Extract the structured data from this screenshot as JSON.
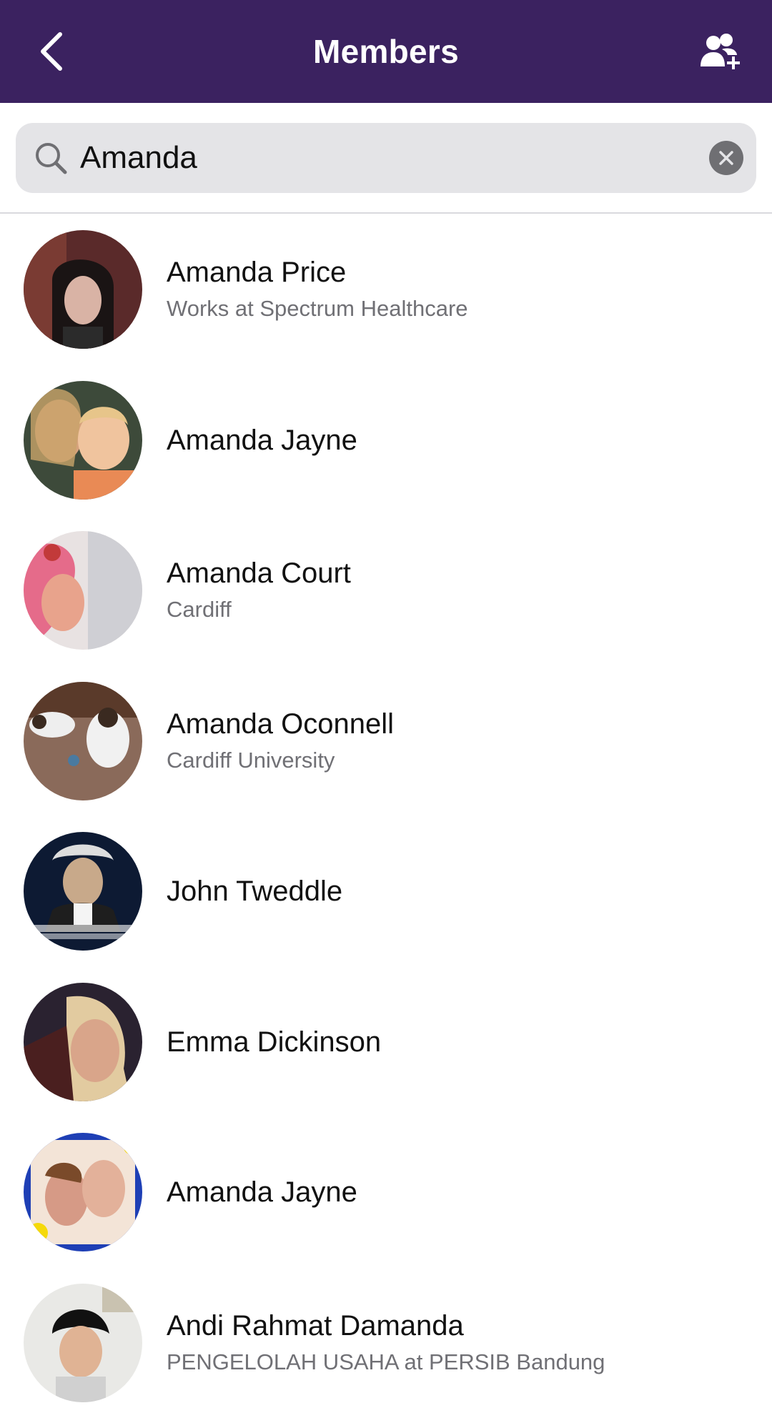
{
  "header": {
    "title": "Members",
    "back_icon": "chevron-left-icon",
    "add_icon": "add-member-icon",
    "background_color": "#3b2260"
  },
  "search": {
    "value": "Amanda",
    "placeholder": "Search",
    "search_icon": "search-icon",
    "clear_icon": "clear-circle-icon"
  },
  "members": [
    {
      "name": "Amanda Price",
      "subtitle": "Works at Spectrum Healthcare"
    },
    {
      "name": "Amanda Jayne",
      "subtitle": ""
    },
    {
      "name": "Amanda Court",
      "subtitle": "Cardiff"
    },
    {
      "name": "Amanda Oconnell",
      "subtitle": "Cardiff University"
    },
    {
      "name": "John Tweddle",
      "subtitle": ""
    },
    {
      "name": "Emma Dickinson",
      "subtitle": ""
    },
    {
      "name": "Amanda Jayne",
      "subtitle": ""
    },
    {
      "name": "Andi Rahmat Damanda",
      "subtitle": "PENGELOLAH USAHA at PERSIB Bandung"
    }
  ]
}
